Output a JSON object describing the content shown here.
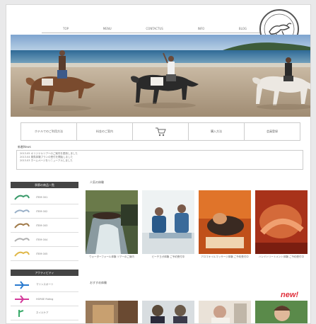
{
  "nav": {
    "items": [
      {
        "label": "TOP"
      },
      {
        "label": "MENU"
      },
      {
        "label": "CONTACTUS"
      },
      {
        "label": "INFO"
      },
      {
        "label": "BLOG"
      }
    ]
  },
  "menubar": {
    "items": [
      {
        "label": "ホテルでのご利用方法"
      },
      {
        "label": "料金のご案内"
      },
      {
        "label": "cart"
      },
      {
        "label": "購入方法"
      },
      {
        "label": "会員登録"
      }
    ]
  },
  "news": {
    "title": "新着News",
    "lines": [
      "2013.05  オリジナルツアーのご案内を更新しました",
      "2013.04  乗馬体験プランの受付を開始しました",
      "2013.03  ホームページをリニューアルしました"
    ]
  },
  "sidebar": {
    "heading1": "季節の商品一覧",
    "items1": [
      {
        "label": "ITEM 001"
      },
      {
        "label": "ITEM 002"
      },
      {
        "label": "ITEM 003"
      },
      {
        "label": "ITEM 004"
      },
      {
        "label": "ITEM 005"
      }
    ],
    "heading2": "アクティビティ",
    "items2": [
      {
        "label": "マリンスポーツ"
      },
      {
        "label": "HORSE Riding"
      },
      {
        "label": "ネイルケア"
      },
      {
        "label": "スパ"
      }
    ]
  },
  "main": {
    "section1_title": "人気の体験",
    "section1_caps": [
      "ウォーターフォール体験 ツアーのご案内",
      "ビーチヨガ体験 ご予約受付中",
      "アロマオイルマッサージ体験 ご予約受付中",
      "ハンドトリートメント体験 ご予約受付中"
    ],
    "section2_title": "おすすめ体験",
    "new_label": "new!"
  },
  "colors": {
    "accent_red": "#e02e3a",
    "dark_header": "#444444"
  }
}
